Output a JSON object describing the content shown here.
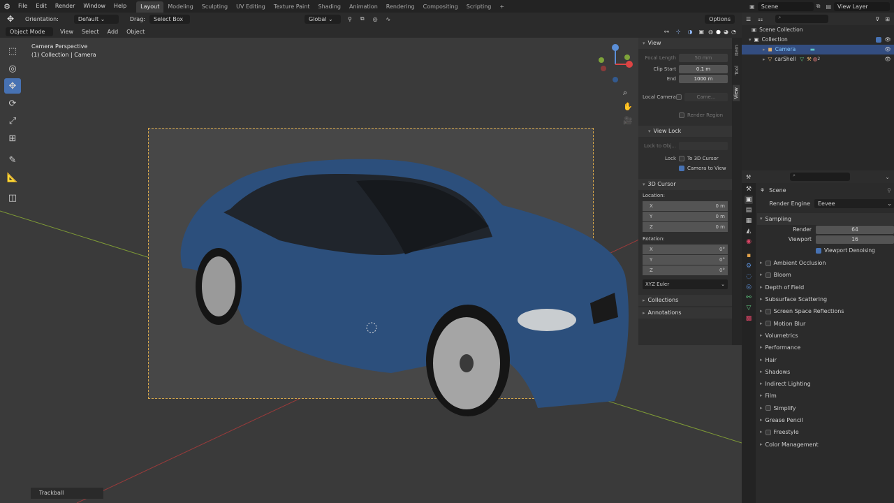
{
  "topbar": {
    "menus": [
      "File",
      "Edit",
      "Render",
      "Window",
      "Help"
    ],
    "workspaces": [
      "Layout",
      "Modeling",
      "Sculpting",
      "UV Editing",
      "Texture Paint",
      "Shading",
      "Animation",
      "Rendering",
      "Compositing",
      "Scripting"
    ],
    "add_tab": "+",
    "scene": "Scene",
    "view_layer": "View Layer"
  },
  "header2": {
    "orientation_label": "Orientation:",
    "orientation_value": "Default",
    "drag_label": "Drag:",
    "drag_value": "Select Box",
    "transform_space": "Global",
    "options": "Options"
  },
  "header3": {
    "mode": "Object Mode",
    "menus": [
      "View",
      "Select",
      "Add",
      "Object"
    ]
  },
  "viewport": {
    "title": "Camera Perspective",
    "subtitle": "(1) Collection | Camera",
    "status_trackball": "Trackball"
  },
  "npanel": {
    "tabs": [
      "Item",
      "Tool",
      "View"
    ],
    "view_header": "View",
    "focal_length_label": "Focal Length",
    "focal_length_value": "50 mm",
    "clip_start_label": "Clip Start",
    "clip_start_value": "0.1 m",
    "end_label": "End",
    "end_value": "1000 m",
    "local_camera_label": "Local Camera",
    "local_camera_value": "Came...",
    "render_region": "Render Region",
    "view_lock_header": "View Lock",
    "lock_to_obj_label": "Lock to Obj...",
    "lock_label": "Lock",
    "to_3d_cursor": "To 3D Cursor",
    "camera_to_view": "Camera to View",
    "cursor_header": "3D Cursor",
    "location_label": "Location:",
    "loc": [
      {
        "axis": "X",
        "val": "0 m"
      },
      {
        "axis": "Y",
        "val": "0 m"
      },
      {
        "axis": "Z",
        "val": "0 m"
      }
    ],
    "rotation_label": "Rotation:",
    "rot": [
      {
        "axis": "X",
        "val": "0°"
      },
      {
        "axis": "Y",
        "val": "0°"
      },
      {
        "axis": "Z",
        "val": "0°"
      }
    ],
    "euler": "XYZ Euler",
    "collections": "Collections",
    "annotations": "Annotations"
  },
  "outliner": {
    "scene_collection": "Scene Collection",
    "collection": "Collection",
    "camera": "Camera",
    "carshell": "carShell",
    "subscript": "2"
  },
  "properties": {
    "scene_label": "Scene",
    "render_engine_label": "Render Engine",
    "render_engine_value": "Eevee",
    "sampling": "Sampling",
    "render_label": "Render",
    "render_value": "64",
    "viewport_label": "Viewport",
    "viewport_value": "16",
    "viewport_denoising": "Viewport Denoising",
    "panels": [
      {
        "label": "Ambient Occlusion",
        "check": true
      },
      {
        "label": "Bloom",
        "check": true
      },
      {
        "label": "Depth of Field",
        "check": false
      },
      {
        "label": "Subsurface Scattering",
        "check": false
      },
      {
        "label": "Screen Space Reflections",
        "check": true
      },
      {
        "label": "Motion Blur",
        "check": true
      },
      {
        "label": "Volumetrics",
        "check": false
      },
      {
        "label": "Performance",
        "check": false
      },
      {
        "label": "Hair",
        "check": false
      },
      {
        "label": "Shadows",
        "check": false
      },
      {
        "label": "Indirect Lighting",
        "check": false
      },
      {
        "label": "Film",
        "check": false
      },
      {
        "label": "Simplify",
        "check": true
      },
      {
        "label": "Grease Pencil",
        "check": false
      },
      {
        "label": "Freestyle",
        "check": true
      },
      {
        "label": "Color Management",
        "check": false
      }
    ]
  },
  "colors": {
    "accent": "#4772b3",
    "camera_frame": "#d6a64a",
    "car_body": "#2c4f7c"
  }
}
